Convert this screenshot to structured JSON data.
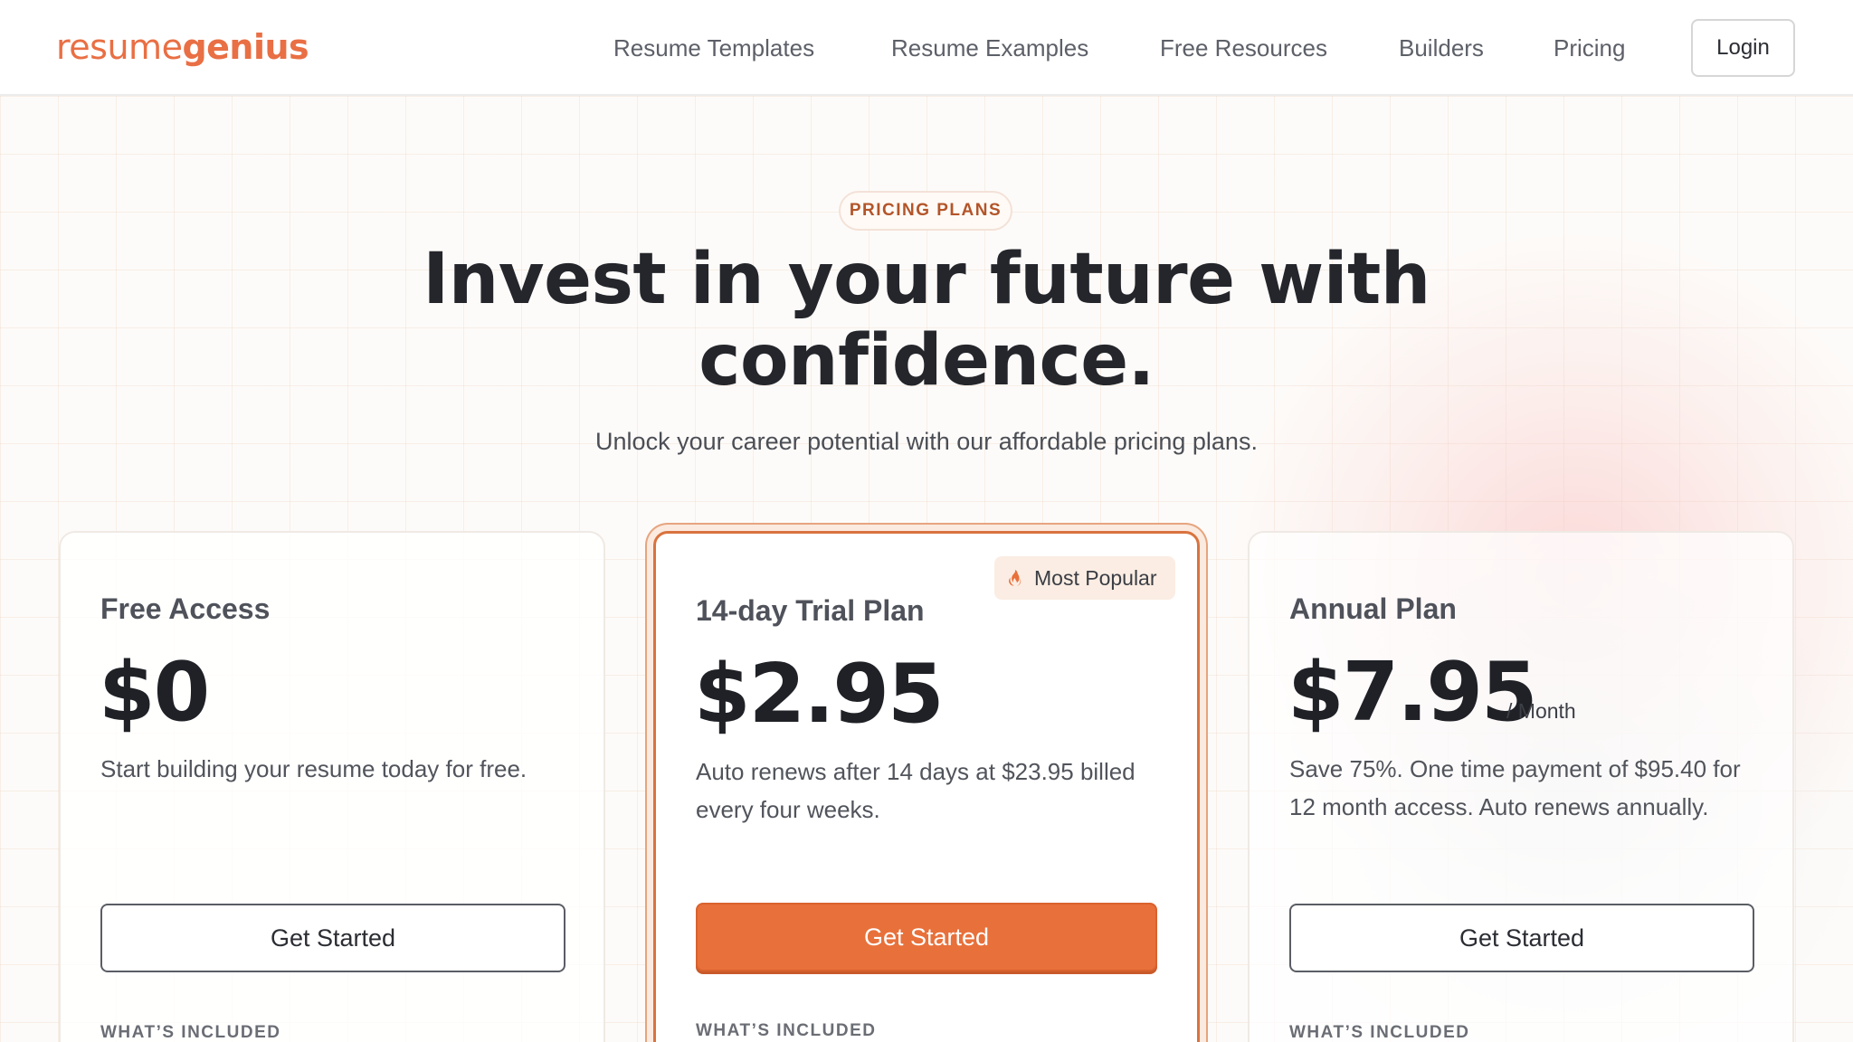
{
  "brand": {
    "logo_part1": "resume",
    "logo_part2": "genius"
  },
  "nav": {
    "items": [
      {
        "label": "Resume Templates"
      },
      {
        "label": "Resume Examples"
      },
      {
        "label": "Free Resources"
      },
      {
        "label": "Builders"
      },
      {
        "label": "Pricing"
      }
    ],
    "login_label": "Login"
  },
  "hero": {
    "badge": "PRICING PLANS",
    "headline_line1": "Invest in your future with",
    "headline_line2": "confidence.",
    "subhead": "Unlock your career potential with our affordable pricing plans."
  },
  "plans": [
    {
      "name": "Free Access",
      "price": "$0",
      "unit": "",
      "description": "Start building your resume today for free.",
      "cta": "Get Started",
      "included_label": "WHAT’S INCLUDED"
    },
    {
      "name": "14-day Trial Plan",
      "badge": "Most Popular",
      "price": "$2.95",
      "unit": "",
      "description": "Auto renews after 14 days at $23.95 billed every four weeks.",
      "cta": "Get Started",
      "included_label": "WHAT’S INCLUDED"
    },
    {
      "name": "Annual Plan",
      "price": "$7.95",
      "unit": "/ Month",
      "description": "Save 75%. One time payment of $95.40 for 12 month access. Auto renews annually.",
      "cta": "Get Started",
      "included_label": "WHAT’S INCLUDED"
    }
  ],
  "colors": {
    "accent": "#e8703a",
    "brand": "#e96f44",
    "badge_text": "#b35529"
  },
  "icons": {
    "popular_badge": "fire-icon"
  }
}
